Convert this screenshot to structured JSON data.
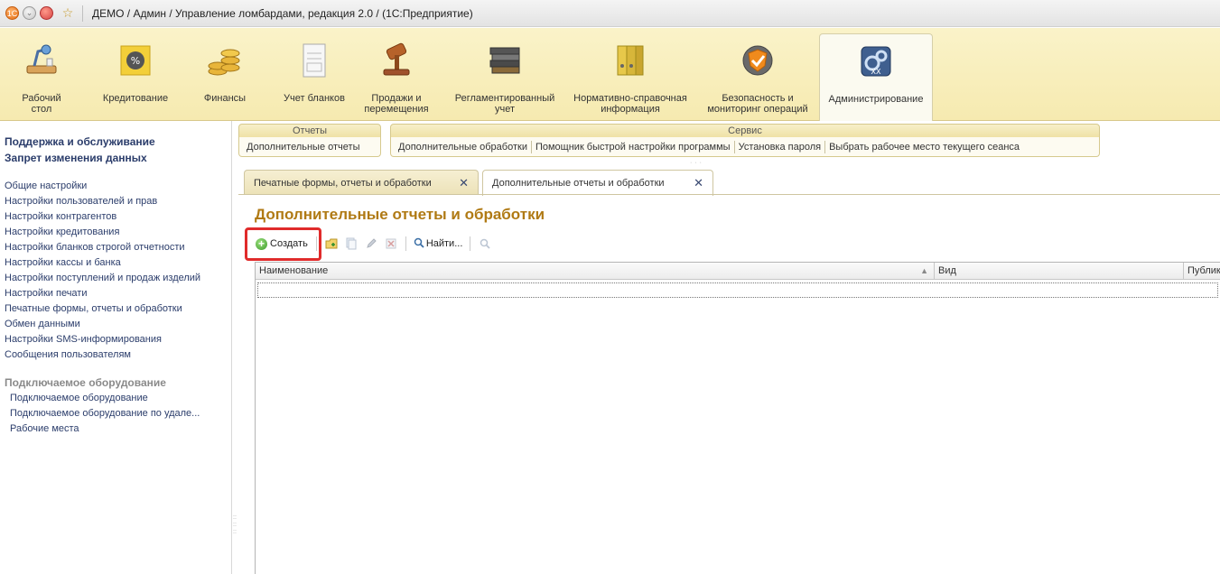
{
  "titlebar": {
    "title": "ДЕМО / Админ / Управление ломбардами, редакция 2.0 /  (1С:Предприятие)"
  },
  "sections": [
    {
      "label": "Рабочий стол",
      "icon": "desk-lamp-icon"
    },
    {
      "label": "Кредитование",
      "icon": "percent-note-icon"
    },
    {
      "label": "Финансы",
      "icon": "coins-icon"
    },
    {
      "label": "Учет бланков",
      "icon": "blank-form-icon"
    },
    {
      "label": "Продажи и перемещения",
      "icon": "gavel-icon"
    },
    {
      "label": "Регламентированный учет",
      "icon": "books-icon"
    },
    {
      "label": "Нормативно-справочная информация",
      "icon": "binders-icon"
    },
    {
      "label": "Безопасность и мониторинг операций",
      "icon": "shield-icon"
    },
    {
      "label": "Администрирование",
      "icon": "admin-gears-icon",
      "active": true
    }
  ],
  "leftnav": {
    "top_links": [
      "Поддержка и обслуживание",
      "Запрет изменения данных"
    ],
    "items": [
      "Общие настройки",
      "Настройки пользователей и прав",
      "Настройки контрагентов",
      "Настройки кредитования",
      "Настройки бланков строгой отчетности",
      "Настройки кассы и банка",
      "Настройки поступлений и продаж изделий",
      "Настройки печати",
      "Печатные формы, отчеты и обработки",
      "Обмен данными",
      "Настройки SMS-информирования",
      "Сообщения пользователям"
    ],
    "group_title": "Подключаемое оборудование",
    "group_items": [
      "Подключаемое оборудование",
      "Подключаемое оборудование по удале...",
      "Рабочие места"
    ]
  },
  "commands": {
    "reports_title": "Отчеты",
    "reports_items": [
      "Дополнительные отчеты"
    ],
    "service_title": "Сервис",
    "service_items": [
      "Дополнительные обработки",
      "Помощник быстрой настройки программы",
      "Установка пароля",
      "Выбрать рабочее место текущего сеанса"
    ]
  },
  "tabs": [
    {
      "label": "Печатные формы, отчеты и обработки",
      "active": false
    },
    {
      "label": "Дополнительные отчеты и обработки",
      "active": true
    }
  ],
  "form": {
    "title": "Дополнительные отчеты и обработки",
    "toolbar": {
      "create_label": "Создать",
      "find_label": "Найти..."
    },
    "table": {
      "columns": [
        "Наименование",
        "Вид",
        "Публика"
      ],
      "rows": []
    }
  },
  "colors": {
    "section_bg": "#f6eab0",
    "form_title": "#b07a14",
    "highlight": "#e02b2b",
    "nav_link": "#2b3d6b"
  }
}
